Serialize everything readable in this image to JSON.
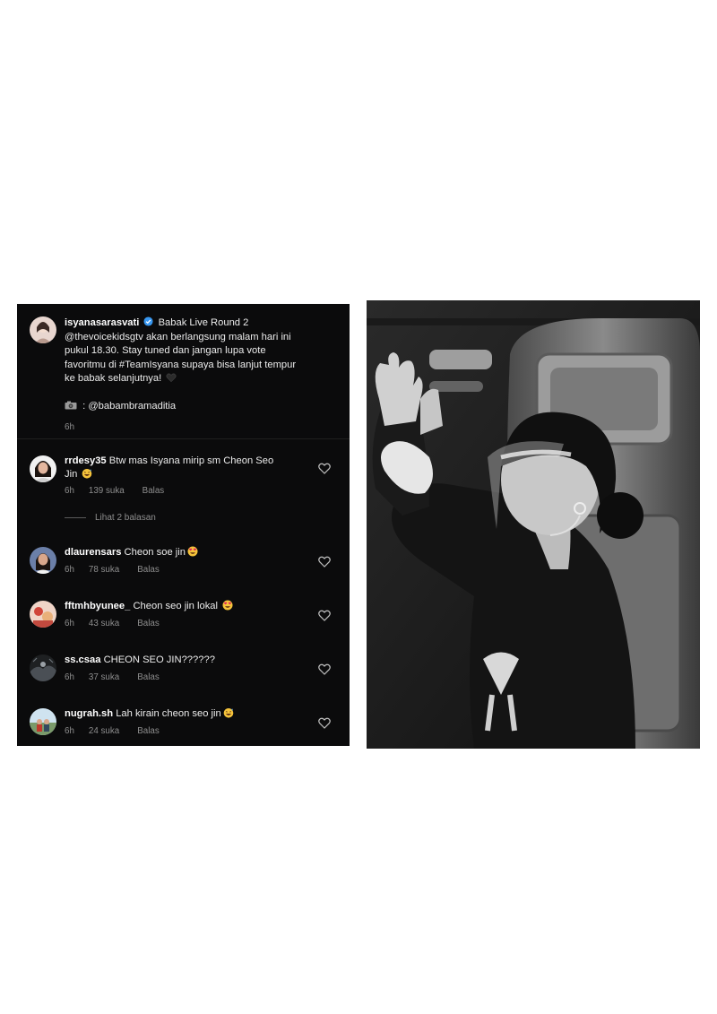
{
  "post": {
    "username": "isyanasarasvati",
    "caption_lines": [
      "Babak Live Round 2",
      "@thevoicekidsgtv akan berlangsung malam hari ini",
      "pukul 18.30. Stay tuned dan jangan lupa vote",
      "favoritmu di #TeamIsyana supaya bisa lanjut tempur",
      "ke babak selanjutnya!"
    ],
    "credit": ": @babambramaditia",
    "time": "6h"
  },
  "comments": [
    {
      "username": "rrdesy35",
      "text_line1": "Btw mas Isyana mirip sm Cheon Seo",
      "text_line2": "Jin",
      "time": "6h",
      "likes": "139 suka",
      "reply": "Balas"
    },
    {
      "username": "dlaurensars",
      "text_line1": "Cheon soe jin",
      "time": "6h",
      "likes": "78 suka",
      "reply": "Balas"
    },
    {
      "username": "fftmhbyunee_",
      "text_line1": "Cheon seo jin lokal",
      "time": "6h",
      "likes": "43 suka",
      "reply": "Balas"
    },
    {
      "username": "ss.csaa",
      "text_line1": "CHEON SEO JIN??????",
      "time": "6h",
      "likes": "37 suka",
      "reply": "Balas"
    },
    {
      "username": "nugrah.sh",
      "text_line1": "Lah kirain cheon seo jin",
      "time": "6h",
      "likes": "24 suka",
      "reply": "Balas"
    }
  ],
  "view_replies": "Lihat 2 balasan",
  "icons": {
    "verified": "verified-badge-icon",
    "heart": "heart-outline-icon",
    "camera": "camera-icon",
    "black_heart": "black-heart-emoji-icon",
    "heart_eyes": "heart-eyes-emoji-icon",
    "grin_sweat": "grinning-sweat-emoji-icon"
  },
  "colors": {
    "panel_bg": "#0b0b0c",
    "text": "#ececec",
    "muted": "#8e8e8e",
    "verified_blue": "#3897f0"
  }
}
